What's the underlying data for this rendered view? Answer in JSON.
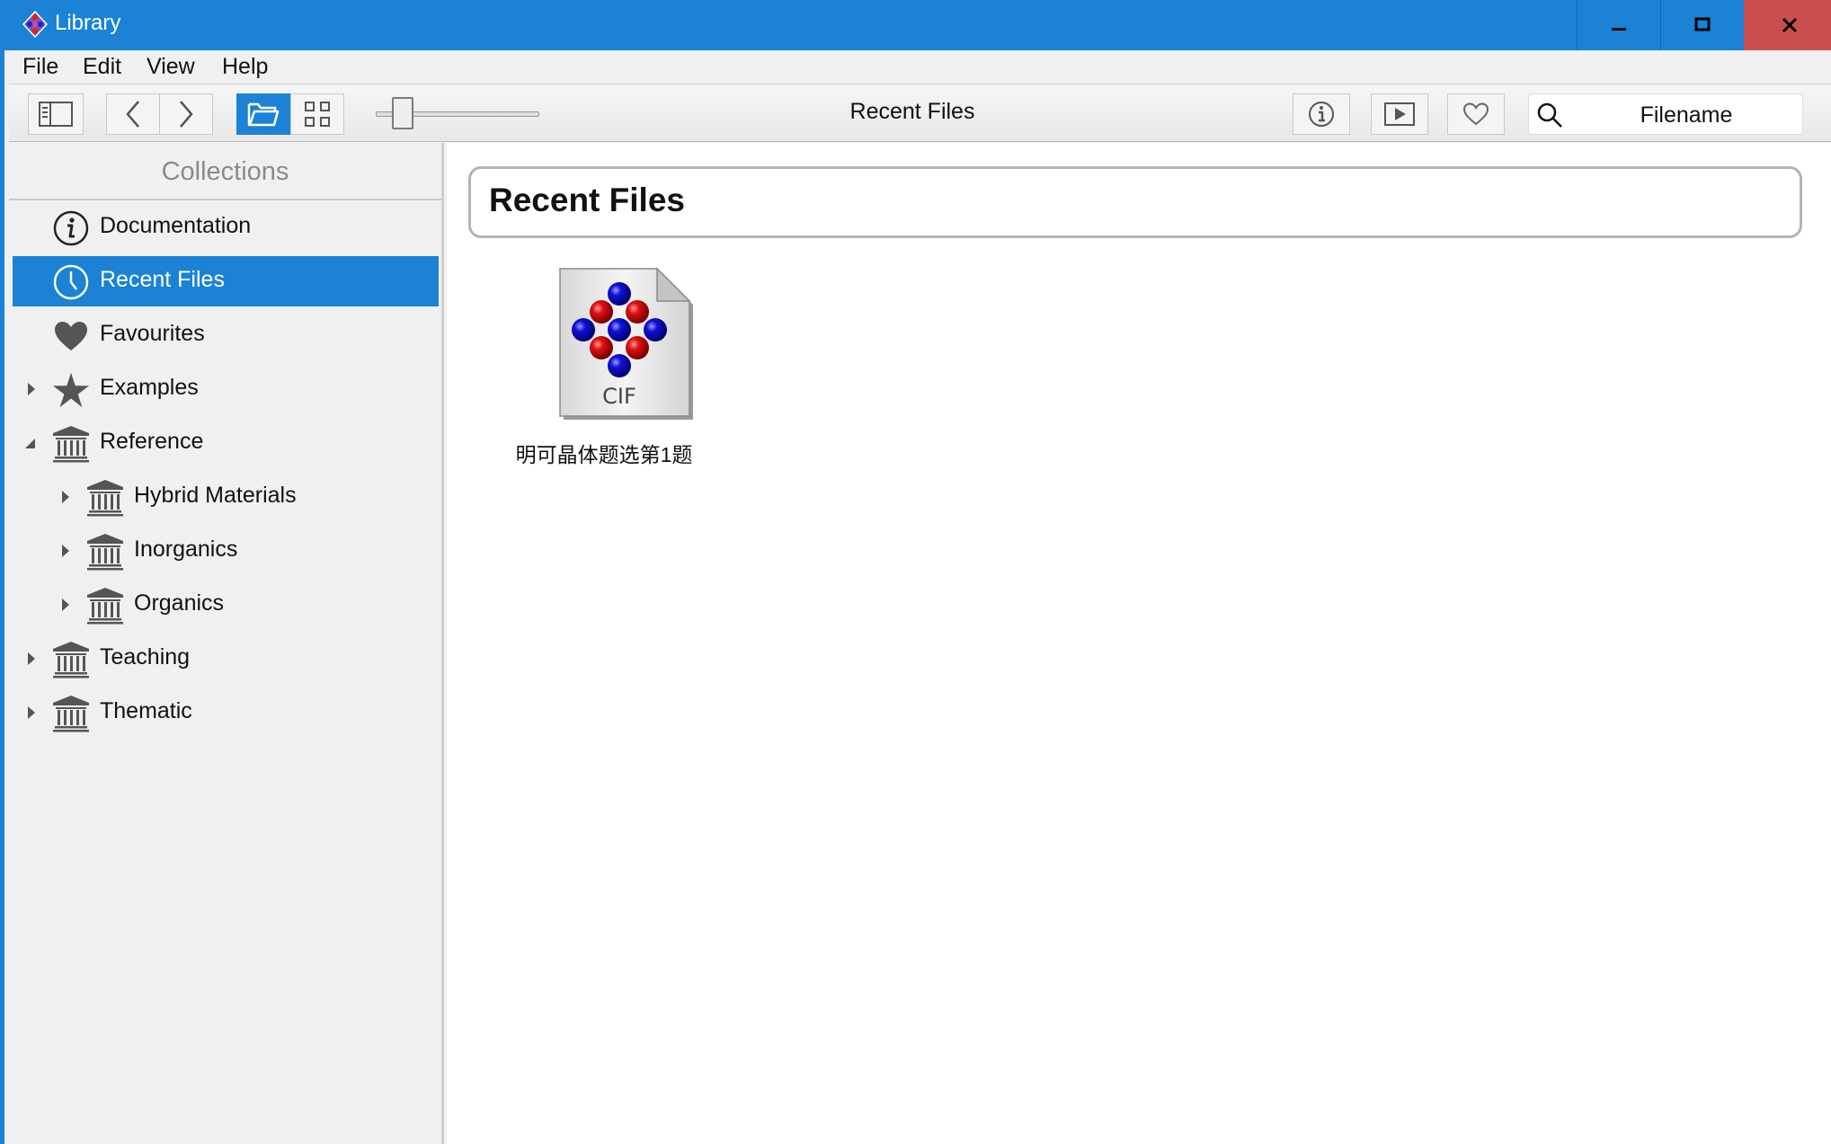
{
  "window": {
    "title": "Library"
  },
  "menu": [
    "File",
    "Edit",
    "View",
    "Help"
  ],
  "toolbar": {
    "title": "Recent Files",
    "search_placeholder": "Filename",
    "active_view": "folder"
  },
  "sidebar": {
    "header": "Collections",
    "items": [
      {
        "label": "Documentation",
        "icon": "info-icon",
        "selected": false
      },
      {
        "label": "Recent Files",
        "icon": "clock-icon",
        "selected": true
      },
      {
        "label": "Favourites",
        "icon": "heart-icon",
        "selected": false
      },
      {
        "label": "Examples",
        "icon": "star-icon",
        "selected": false,
        "expand": "collapsed"
      },
      {
        "label": "Reference",
        "icon": "library-icon",
        "selected": false,
        "expand": "expanded"
      },
      {
        "label": "Hybrid Materials",
        "icon": "library-icon",
        "selected": false,
        "expand": "collapsed"
      },
      {
        "label": "Inorganics",
        "icon": "library-icon",
        "selected": false,
        "expand": "collapsed"
      },
      {
        "label": "Organics",
        "icon": "library-icon",
        "selected": false,
        "expand": "collapsed"
      },
      {
        "label": "Teaching",
        "icon": "library-icon",
        "selected": false,
        "expand": "collapsed"
      },
      {
        "label": "Thematic",
        "icon": "library-icon",
        "selected": false,
        "expand": "collapsed"
      }
    ]
  },
  "main": {
    "header": "Recent Files",
    "files": [
      {
        "badge": "CIF",
        "name": "明可晶体题选第1题"
      }
    ]
  },
  "colors": {
    "accent": "#1b82d6",
    "close": "#c94f4f",
    "atom_red": "#e01010",
    "atom_blue": "#1010d8"
  }
}
